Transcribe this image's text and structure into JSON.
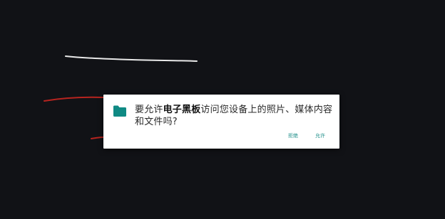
{
  "canvas": {
    "background": "#111216",
    "strokes": [
      {
        "color": "#e9e9e9",
        "name": "white-stroke"
      },
      {
        "color": "#b7241f",
        "name": "red-stroke-1"
      },
      {
        "color": "#b7241f",
        "name": "red-stroke-2"
      }
    ]
  },
  "dialog": {
    "icon": "folder-icon",
    "icon_color": "#0f8a84",
    "message_prefix": "要允许",
    "app_name": "电子黑板",
    "message_suffix": "访问您设备上的照片、媒体内容和文件吗?",
    "deny_label": "拒绝",
    "allow_label": "允许",
    "accent_color": "#1f8f8a"
  }
}
